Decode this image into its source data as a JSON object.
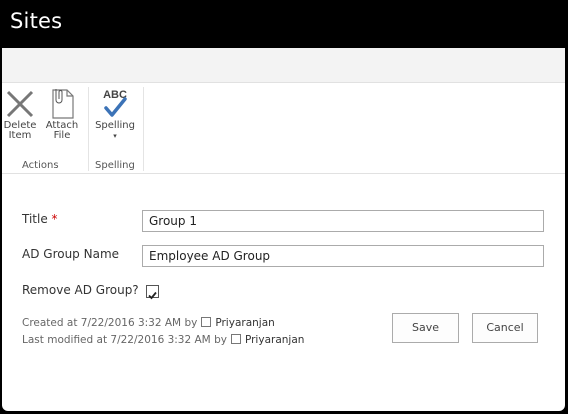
{
  "header": {
    "title": "Sites"
  },
  "ribbon": {
    "delete": {
      "line1": "Delete",
      "line2": "Item"
    },
    "attach": {
      "line1": "Attach",
      "line2": "File"
    },
    "spelling": {
      "abc": "ABC",
      "label": "Spelling"
    },
    "groups": {
      "actions": "Actions",
      "spelling": "Spelling"
    }
  },
  "form": {
    "title_label": "Title",
    "required_mark": "*",
    "title_value": "Group 1",
    "ad_group_label": "AD Group Name",
    "ad_group_value": "Employee AD Group",
    "remove_label": "Remove AD Group?",
    "remove_checked": true
  },
  "meta": {
    "created_text": "Created at 7/22/2016 3:32 AM  by",
    "created_user": "Priyaranjan",
    "modified_text": "Last modified at 7/22/2016 3:32 AM  by",
    "modified_user": "Priyaranjan"
  },
  "buttons": {
    "save": "Save",
    "cancel": "Cancel"
  },
  "colors": {
    "accent": "#3c73b7",
    "header_bg": "#000000"
  }
}
